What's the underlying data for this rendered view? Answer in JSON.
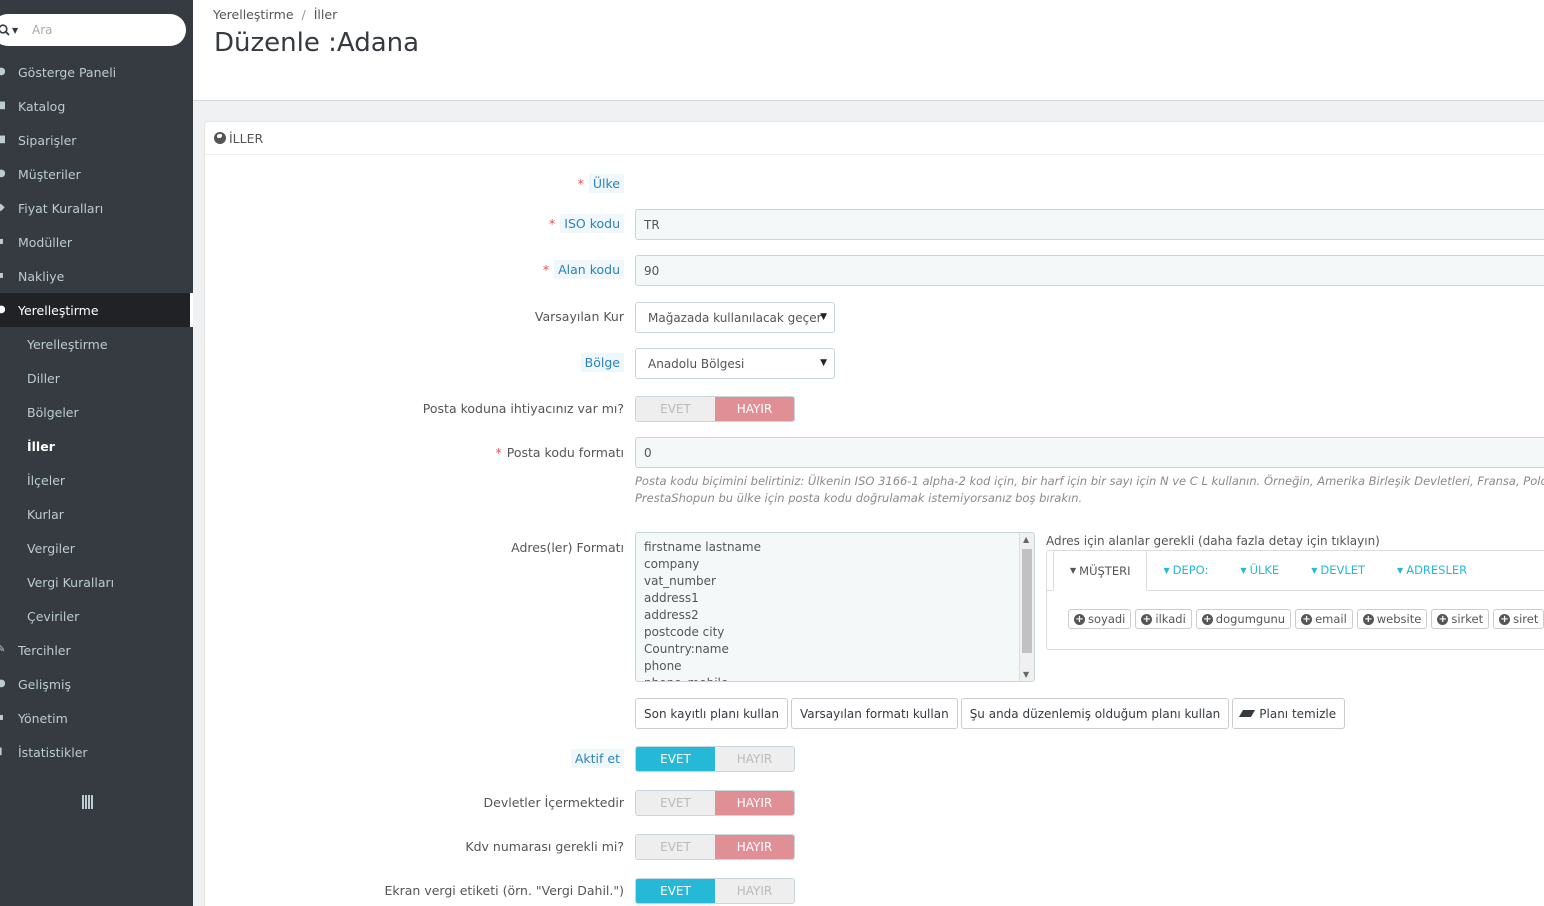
{
  "sidebar": {
    "search_placeholder": "Ara",
    "menu": [
      {
        "label": "Gösterge Paneli",
        "icon": "dashboard-icon"
      },
      {
        "label": "Katalog",
        "icon": "catalog-icon"
      },
      {
        "label": "Siparişler",
        "icon": "orders-icon"
      },
      {
        "label": "Müşteriler",
        "icon": "customers-icon"
      },
      {
        "label": "Fiyat Kuralları",
        "icon": "price-rules-icon"
      },
      {
        "label": "Modüller",
        "icon": "modules-icon"
      },
      {
        "label": "Nakliye",
        "icon": "shipping-icon"
      },
      {
        "label": "Yerelleştirme",
        "icon": "localization-icon"
      }
    ],
    "submenu": [
      "Yerelleştirme",
      "Diller",
      "Bölgeler",
      "İller",
      "İlçeler",
      "Kurlar",
      "Vergiler",
      "Vergi Kuralları",
      "Çeviriler"
    ],
    "menu_after": [
      {
        "label": "Tercihler",
        "icon": "preferences-icon"
      },
      {
        "label": "Gelişmiş",
        "icon": "advanced-icon"
      },
      {
        "label": "Yönetim",
        "icon": "administration-icon"
      },
      {
        "label": "İstatistikler",
        "icon": "stats-icon"
      }
    ]
  },
  "header": {
    "breadcrumb": [
      "Yerelleştirme",
      "İller"
    ],
    "breadcrumb_sep": "/",
    "title": "Düzenle :Adana"
  },
  "panel": {
    "heading": "İLLER",
    "fields": {
      "country_label": "Ülke",
      "iso_label": "ISO kodu",
      "iso_value": "TR",
      "call_prefix_label": "Alan kodu",
      "call_prefix_value": "90",
      "currency_label": "Varsayılan Kur",
      "currency_value": "Mağazada kullanılacak geçer",
      "zone_label": "Bölge",
      "zone_value": "Anadolu Bölgesi",
      "need_zip_label": "Posta koduna ihtiyacınız var mı?",
      "zip_format_label": "Posta kodu formatı",
      "zip_format_value": "0",
      "zip_help_1": "Posta kodu biçimini belirtiniz: Ülkenin ISO 3166-1 alpha-2 kod için, bir harf için bir sayı için N ve C L kullanın. Örneğin, Amerika Birleşik Devletleri, Fransa, Polonya ve",
      "zip_help_2": "PrestaShopun bu ülke için posta kodu doğrulamak istemiyorsanız boş bırakın.",
      "address_format_label": "Adres(ler) Formatı",
      "address_lines": [
        "firstname lastname",
        "company",
        "vat_number",
        "address1",
        "address2",
        "postcode city",
        "Country:name",
        "phone",
        "phone_mobile"
      ],
      "address_help": "Adres için alanlar gerekli (daha fazla detay için tıklayın)",
      "tabs": [
        "MÜŞTERI",
        "DEPO:",
        "ÜLKE",
        "DEVLET",
        "ADRESLER"
      ],
      "chips": [
        "soyadi",
        "ilkadi",
        "dogumgunu",
        "email",
        "website",
        "sirket",
        "siret"
      ],
      "buttons": [
        "Son kayıtlı planı kullan",
        "Varsayılan formatı kullan",
        "Şu anda düzenlemiş olduğum planı kullan",
        "Planı temizle"
      ],
      "active_label": "Aktif et",
      "contains_states_label": "Devletler İçermektedir",
      "vat_label": "Kdv numarası gerekli mi?",
      "display_tax_label": "Ekran vergi etiketi (örn. \"Vergi Dahil.\")"
    },
    "toggle_yes": "EVET",
    "toggle_no": "HAYIR",
    "toggles": {
      "need_zip": "no",
      "active": "yes",
      "contains_states": "no",
      "vat_required": "no",
      "display_tax": "yes"
    }
  },
  "colors": {
    "sidebar_bg": "#363a41",
    "accent": "#25b9d7",
    "toggle_no_active": "#e08f95",
    "required": "#e84e4e"
  }
}
